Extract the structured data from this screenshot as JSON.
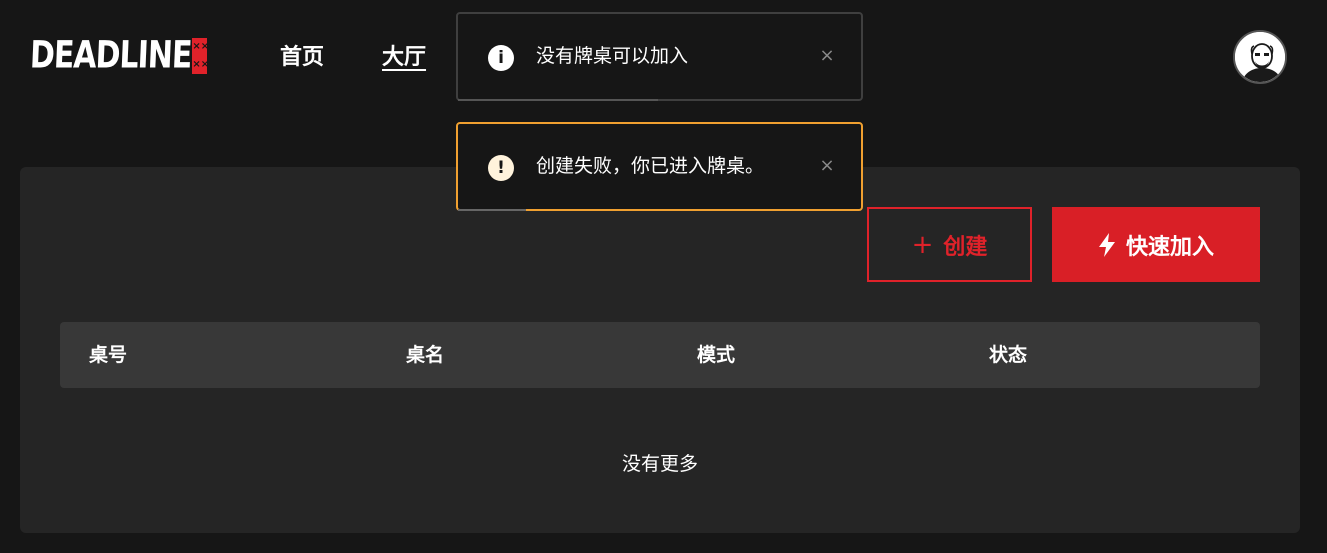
{
  "header": {
    "logo_text": "DEADLINE",
    "logo_badge": [
      "××",
      "××"
    ],
    "nav": [
      {
        "label": "首页",
        "active": false
      },
      {
        "label": "大厅",
        "active": true
      }
    ]
  },
  "actions": {
    "create_icon": "+",
    "create_label": "创建",
    "quick_join_label": "快速加入"
  },
  "table": {
    "columns": [
      "桌号",
      "桌名",
      "模式",
      "状态"
    ],
    "rows": [],
    "empty_text": "没有更多"
  },
  "toasts": [
    {
      "type": "info",
      "icon": "i",
      "message": "没有牌桌可以加入",
      "close": "×"
    },
    {
      "type": "warning",
      "icon": "!",
      "message": "创建失败，你已进入牌桌。",
      "close": "×"
    }
  ],
  "colors": {
    "accent": "#d91f26",
    "warning_border": "#f0a030",
    "background": "#161616",
    "panel": "#252525"
  }
}
